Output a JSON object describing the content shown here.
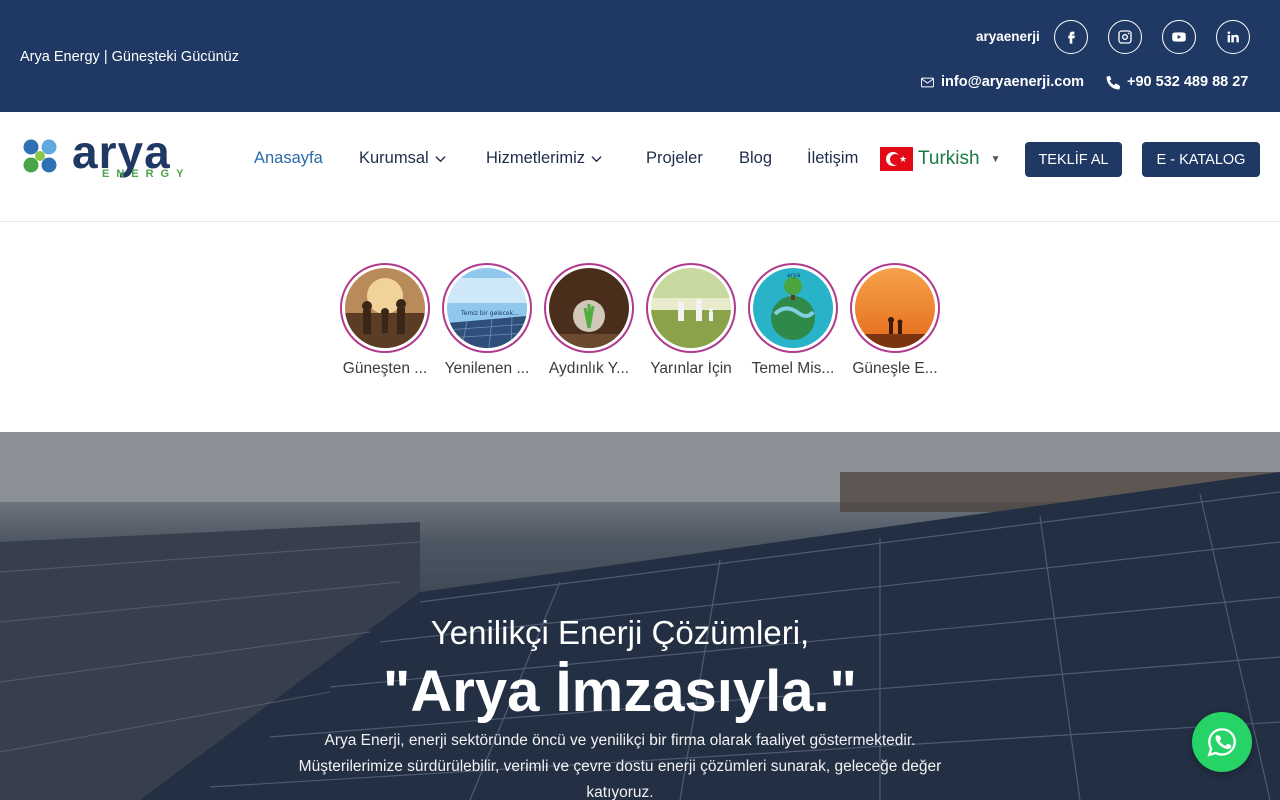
{
  "topbar": {
    "tagline": "Arya Energy | Güneşteki Gücünüz",
    "handle": "aryaenerji",
    "social": [
      "facebook-icon",
      "instagram-icon",
      "youtube-icon",
      "linkedin-icon"
    ],
    "email": "info@aryaenerji.com",
    "phone": "+90 532 489 88 27"
  },
  "logo": {
    "text": "arya",
    "sub": "ENERGY"
  },
  "nav": {
    "items": [
      {
        "label": "Anasayfa"
      },
      {
        "label": "Kurumsal"
      },
      {
        "label": "Hizmetlerimiz"
      },
      {
        "label": "Projeler"
      },
      {
        "label": "Blog"
      },
      {
        "label": "İletişim"
      }
    ],
    "language": "Turkish",
    "quote_button": "TEKLİF AL",
    "catalog_button": "E - KATALOG"
  },
  "stories": [
    {
      "caption": "Güneşten ..."
    },
    {
      "caption": "Yenilenen ..."
    },
    {
      "caption": "Aydınlık Y..."
    },
    {
      "caption": "Yarınlar İçin"
    },
    {
      "caption": "Temel Mis..."
    },
    {
      "caption": "Güneşle E..."
    }
  ],
  "story_image_texts": {
    "s2": "Temiz bir gelecek...",
    "s5": "arya"
  },
  "hero": {
    "subtitle": "Yenilikçi Enerji Çözümleri,",
    "title": "\"Arya İmzasıyla.\"",
    "text": "Arya Enerji, enerji sektöründe öncü ve yenilikçi bir firma olarak faaliyet göstermektedir. Müşterilerimize sürdürülebilir, verimli ve çevre dostu enerji çözümleri sunarak, geleceğe değer katıyoruz."
  },
  "colors": {
    "primary": "#1f3864",
    "accent": "#2b6aa8",
    "whatsapp": "#25d366",
    "story_ring": "#b03a8c",
    "lang": "#1b7a45"
  }
}
